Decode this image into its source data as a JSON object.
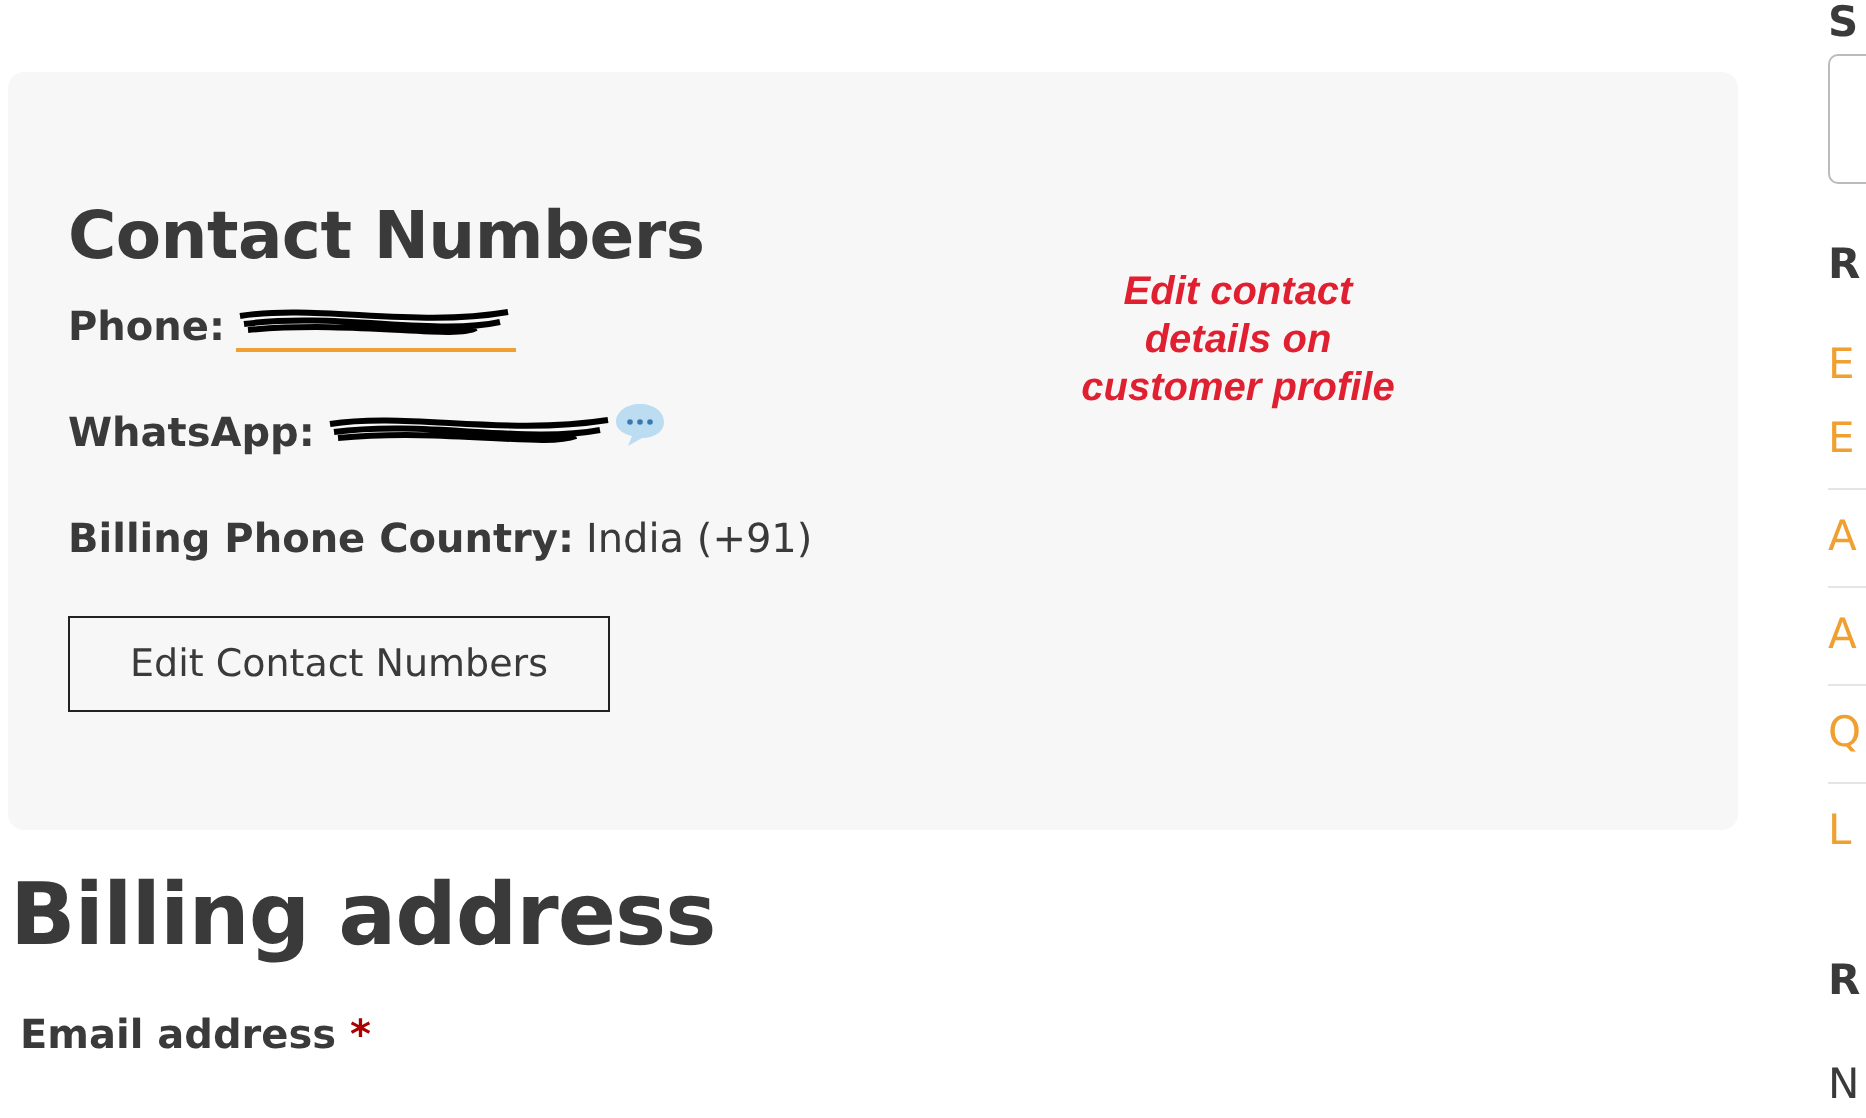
{
  "contact_card": {
    "title": "Contact Numbers",
    "fields": [
      {
        "kind": "phone",
        "label": "Phone:",
        "redacted": true
      },
      {
        "kind": "whatsapp",
        "label": "WhatsApp:",
        "redacted": true
      },
      {
        "kind": "text",
        "label": "Billing Phone Country:",
        "value": "India (+91)"
      }
    ],
    "button": "Edit Contact Numbers",
    "annotation": "Edit contact details on customer profile"
  },
  "billing": {
    "title": "Billing address",
    "field_label": "Email address",
    "required_mark": "*"
  },
  "sidebar": {
    "heading_1": "S",
    "heading_2": "R",
    "links": [
      "E",
      "E",
      "A",
      "A",
      "Q",
      "L"
    ],
    "heading_3": "R",
    "text": "N"
  }
}
